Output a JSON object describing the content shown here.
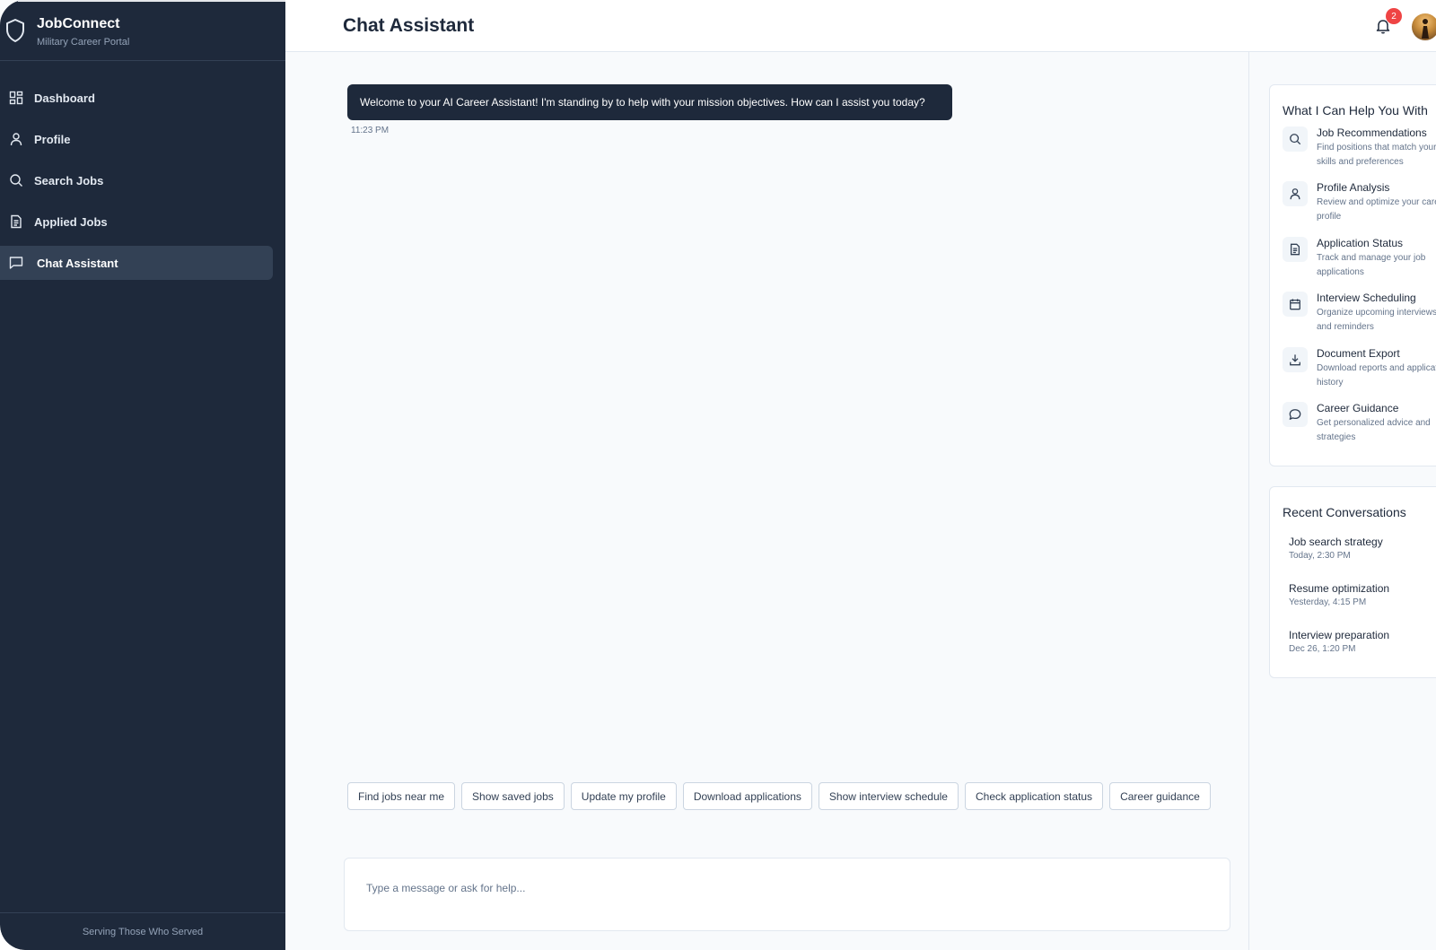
{
  "brand": {
    "title": "JobConnect",
    "subtitle": "Military Career Portal",
    "icon": "shield-icon"
  },
  "sidebar": {
    "items": [
      {
        "label": "Dashboard",
        "icon": "grid-icon",
        "active": false
      },
      {
        "label": "Profile",
        "icon": "user-icon",
        "active": false
      },
      {
        "label": "Search Jobs",
        "icon": "search-icon",
        "active": false
      },
      {
        "label": "Applied Jobs",
        "icon": "document-icon",
        "active": false
      },
      {
        "label": "Chat Assistant",
        "icon": "chat-icon",
        "active": true
      }
    ],
    "footer": "Serving Those Who Served"
  },
  "header": {
    "title": "Chat Assistant",
    "notification_count": "2"
  },
  "chat": {
    "messages": [
      {
        "text": "Welcome to your AI Career Assistant! I'm standing by to help with your mission objectives. How can I assist you today?",
        "time": "11:23 PM"
      }
    ],
    "quick_actions": [
      "Find jobs near me",
      "Show saved jobs",
      "Update my profile",
      "Download applications",
      "Show interview schedule",
      "Check application status",
      "Career guidance"
    ],
    "input_placeholder": "Type a message or ask for help..."
  },
  "help_panel": {
    "title": "What I Can Help You With",
    "items": [
      {
        "title": "Job Recommendations",
        "desc": "Find positions that match your skills and preferences",
        "icon": "search-icon"
      },
      {
        "title": "Profile Analysis",
        "desc": "Review and optimize your career profile",
        "icon": "user-icon"
      },
      {
        "title": "Application Status",
        "desc": "Track and manage your job applications",
        "icon": "document-icon"
      },
      {
        "title": "Interview Scheduling",
        "desc": "Organize upcoming interviews and reminders",
        "icon": "calendar-icon"
      },
      {
        "title": "Document Export",
        "desc": "Download reports and application history",
        "icon": "download-icon"
      },
      {
        "title": "Career Guidance",
        "desc": "Get personalized advice and strategies",
        "icon": "chat-icon"
      }
    ]
  },
  "recent": {
    "title": "Recent Conversations",
    "items": [
      {
        "title": "Job search strategy",
        "time": "Today, 2:30 PM"
      },
      {
        "title": "Resume optimization",
        "time": "Yesterday, 4:15 PM"
      },
      {
        "title": "Interview preparation",
        "time": "Dec 26, 1:20 PM"
      }
    ]
  },
  "colors": {
    "sidebar_bg": "#1e293b",
    "active_item_bg": "#334155",
    "badge": "#ef4444",
    "page_bg": "#f8fafc"
  }
}
